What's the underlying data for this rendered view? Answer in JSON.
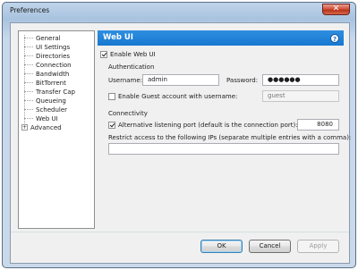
{
  "window": {
    "title": "Preferences",
    "close_glyph": "✕"
  },
  "sidebar": {
    "items": [
      {
        "label": "General"
      },
      {
        "label": "UI Settings"
      },
      {
        "label": "Directories"
      },
      {
        "label": "Connection"
      },
      {
        "label": "Bandwidth"
      },
      {
        "label": "BitTorrent"
      },
      {
        "label": "Transfer Cap"
      },
      {
        "label": "Queueing"
      },
      {
        "label": "Scheduler"
      },
      {
        "label": "Web UI",
        "selected": true
      },
      {
        "label": "Advanced",
        "expandable": true,
        "expander": "+"
      }
    ]
  },
  "panel": {
    "title": "Web UI",
    "help_glyph": "?",
    "enable_label": "Enable Web UI",
    "enable_checked": true,
    "auth_heading": "Authentication",
    "username_label": "Username:",
    "username_value": "admin",
    "password_label": "Password:",
    "password_value": "●●●●●●",
    "guest_label": "Enable Guest account with username:",
    "guest_checked": false,
    "guest_value": "guest",
    "connectivity_heading": "Connectivity",
    "port_label": "Alternative listening port (default is the connection port):",
    "port_checked": true,
    "port_value": "8080",
    "restrict_label": "Restrict access to the following IPs (separate multiple entries with a comma):",
    "restrict_value": ""
  },
  "footer": {
    "ok_label": "OK",
    "cancel_label": "Cancel",
    "apply_label": "Apply"
  }
}
